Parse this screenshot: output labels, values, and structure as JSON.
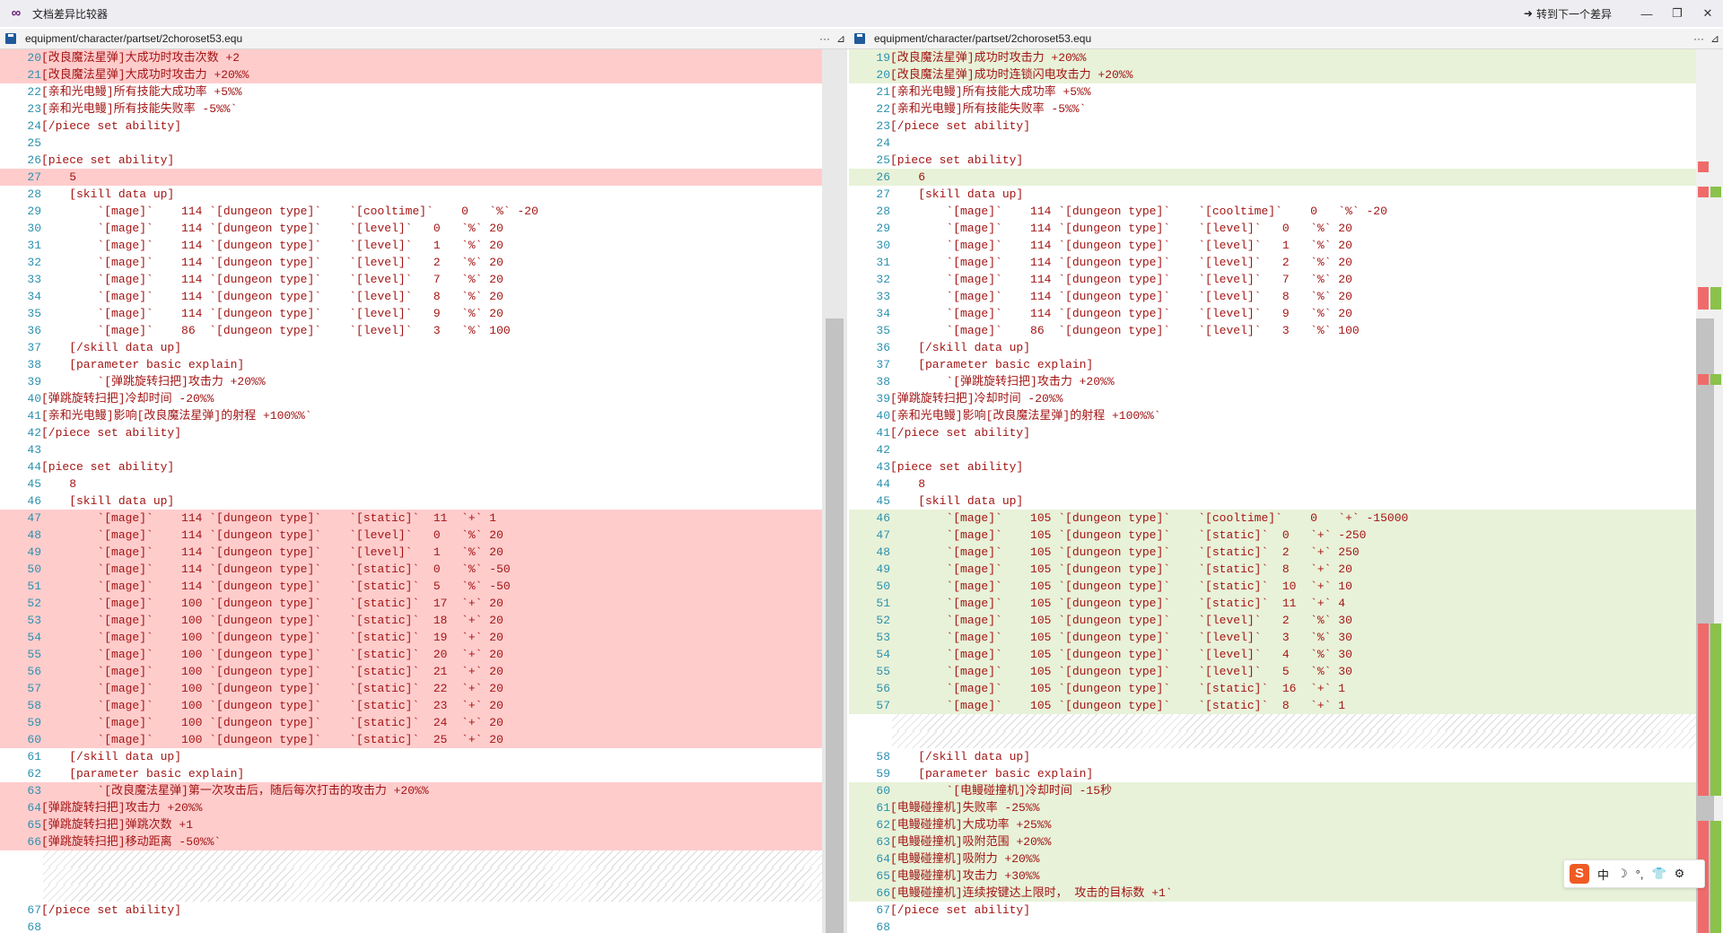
{
  "window": {
    "title": "文档差异比较器",
    "next_diff_label": "转到下一个差异",
    "app_icon": "visual-studio-icon"
  },
  "left_pane": {
    "path": "equipment/character/partset/2choroset53.equ"
  },
  "right_pane": {
    "path": "equipment/character/partset/2choroset53.equ"
  },
  "colors": {
    "removed": "#ffcccc",
    "removed_strong": "#f08e8e",
    "added": "#e8f2d8",
    "added_strong": "#c9df8e",
    "hatch": "#dadada",
    "map_red": "#ef6b6b",
    "map_green": "#8ac24a"
  },
  "left_lines": [
    {
      "n": "20",
      "t": "[改良魔法星弹]大成功时攻击次数 +2",
      "d": "r"
    },
    {
      "n": "21",
      "t": "[改良魔法星弹]大成功时攻击力 +20%%",
      "d": "r"
    },
    {
      "n": "22",
      "t": "[亲和光电鳗]所有技能大成功率 +5%%"
    },
    {
      "n": "23",
      "t": "[亲和光电鳗]所有技能失败率 -5%%`"
    },
    {
      "n": "24",
      "t": "[/piece set ability]"
    },
    {
      "n": "25",
      "t": ""
    },
    {
      "n": "26",
      "t": "[piece set ability]"
    },
    {
      "n": "27",
      "t": "    5",
      "d": "r"
    },
    {
      "n": "28",
      "t": "    [skill data up]"
    },
    {
      "n": "29",
      "t": "        `[mage]`    114 `[dungeon type]`    `[cooltime]`    0   `%` -20"
    },
    {
      "n": "30",
      "t": "        `[mage]`    114 `[dungeon type]`    `[level]`   0   `%` 20"
    },
    {
      "n": "31",
      "t": "        `[mage]`    114 `[dungeon type]`    `[level]`   1   `%` 20"
    },
    {
      "n": "32",
      "t": "        `[mage]`    114 `[dungeon type]`    `[level]`   2   `%` 20"
    },
    {
      "n": "33",
      "t": "        `[mage]`    114 `[dungeon type]`    `[level]`   7   `%` 20"
    },
    {
      "n": "34",
      "t": "        `[mage]`    114 `[dungeon type]`    `[level]`   8   `%` 20"
    },
    {
      "n": "35",
      "t": "        `[mage]`    114 `[dungeon type]`    `[level]`   9   `%` 20"
    },
    {
      "n": "36",
      "t": "        `[mage]`    86  `[dungeon type]`    `[level]`   3   `%` 100"
    },
    {
      "n": "37",
      "t": "    [/skill data up]"
    },
    {
      "n": "38",
      "t": "    [parameter basic explain]"
    },
    {
      "n": "39",
      "t": "        `[弹跳旋转扫把]攻击力 +20%%"
    },
    {
      "n": "40",
      "t": "[弹跳旋转扫把]冷却时间 -20%%"
    },
    {
      "n": "41",
      "t": "[亲和光电鳗]影响[改良魔法星弹]的射程 +100%%`"
    },
    {
      "n": "42",
      "t": "[/piece set ability]"
    },
    {
      "n": "43",
      "t": ""
    },
    {
      "n": "44",
      "t": "[piece set ability]"
    },
    {
      "n": "45",
      "t": "    8"
    },
    {
      "n": "46",
      "t": "    [skill data up]"
    },
    {
      "n": "47",
      "t": "        `[mage]`    114 `[dungeon type]`    `[static]`  11  `+` 1",
      "d": "r"
    },
    {
      "n": "48",
      "t": "        `[mage]`    114 `[dungeon type]`    `[level]`   0   `%` 20",
      "d": "r"
    },
    {
      "n": "49",
      "t": "        `[mage]`    114 `[dungeon type]`    `[level]`   1   `%` 20",
      "d": "r"
    },
    {
      "n": "50",
      "t": "        `[mage]`    114 `[dungeon type]`    `[static]`  0   `%` -50",
      "d": "r"
    },
    {
      "n": "51",
      "t": "        `[mage]`    114 `[dungeon type]`    `[static]`  5   `%` -50",
      "d": "r"
    },
    {
      "n": "52",
      "t": "        `[mage]`    100 `[dungeon type]`    `[static]`  17  `+` 20",
      "d": "r"
    },
    {
      "n": "53",
      "t": "        `[mage]`    100 `[dungeon type]`    `[static]`  18  `+` 20",
      "d": "r"
    },
    {
      "n": "54",
      "t": "        `[mage]`    100 `[dungeon type]`    `[static]`  19  `+` 20",
      "d": "r"
    },
    {
      "n": "55",
      "t": "        `[mage]`    100 `[dungeon type]`    `[static]`  20  `+` 20",
      "d": "r"
    },
    {
      "n": "56",
      "t": "        `[mage]`    100 `[dungeon type]`    `[static]`  21  `+` 20",
      "d": "r"
    },
    {
      "n": "57",
      "t": "        `[mage]`    100 `[dungeon type]`    `[static]`  22  `+` 20",
      "d": "r"
    },
    {
      "n": "58",
      "t": "        `[mage]`    100 `[dungeon type]`    `[static]`  23  `+` 20",
      "d": "r"
    },
    {
      "n": "59",
      "t": "        `[mage]`    100 `[dungeon type]`    `[static]`  24  `+` 20",
      "d": "r"
    },
    {
      "n": "60",
      "t": "        `[mage]`    100 `[dungeon type]`    `[static]`  25  `+` 20",
      "d": "r"
    },
    {
      "n": "61",
      "t": "    [/skill data up]"
    },
    {
      "n": "62",
      "t": "    [parameter basic explain]"
    },
    {
      "n": "63",
      "t": "        `[改良魔法星弹]第一次攻击后，随后每次打击的攻击力 +20%%",
      "d": "r"
    },
    {
      "n": "64",
      "t": "[弹跳旋转扫把]攻击力 +20%%",
      "d": "r"
    },
    {
      "n": "65",
      "t": "[弹跳旋转扫把]弹跳次数 +1",
      "d": "r"
    },
    {
      "n": "66",
      "t": "[弹跳旋转扫把]移动距离 -50%%`",
      "d": "r"
    },
    {
      "n": "",
      "t": "",
      "d": "h"
    },
    {
      "n": "",
      "t": "",
      "d": "h"
    },
    {
      "n": "",
      "t": "",
      "d": "h"
    },
    {
      "n": "67",
      "t": "[/piece set ability]"
    },
    {
      "n": "68",
      "t": ""
    }
  ],
  "right_lines": [
    {
      "n": "19",
      "t": "[改良魔法星弹]成功时攻击力 +20%%",
      "d": "a"
    },
    {
      "n": "20",
      "t": "[改良魔法星弹]成功时连锁闪电攻击力 +20%%",
      "d": "a"
    },
    {
      "n": "21",
      "t": "[亲和光电鳗]所有技能大成功率 +5%%"
    },
    {
      "n": "22",
      "t": "[亲和光电鳗]所有技能失败率 -5%%`"
    },
    {
      "n": "23",
      "t": "[/piece set ability]"
    },
    {
      "n": "24",
      "t": ""
    },
    {
      "n": "25",
      "t": "[piece set ability]"
    },
    {
      "n": "26",
      "t": "    6",
      "d": "a"
    },
    {
      "n": "27",
      "t": "    [skill data up]"
    },
    {
      "n": "28",
      "t": "        `[mage]`    114 `[dungeon type]`    `[cooltime]`    0   `%` -20"
    },
    {
      "n": "29",
      "t": "        `[mage]`    114 `[dungeon type]`    `[level]`   0   `%` 20"
    },
    {
      "n": "30",
      "t": "        `[mage]`    114 `[dungeon type]`    `[level]`   1   `%` 20"
    },
    {
      "n": "31",
      "t": "        `[mage]`    114 `[dungeon type]`    `[level]`   2   `%` 20"
    },
    {
      "n": "32",
      "t": "        `[mage]`    114 `[dungeon type]`    `[level]`   7   `%` 20"
    },
    {
      "n": "33",
      "t": "        `[mage]`    114 `[dungeon type]`    `[level]`   8   `%` 20"
    },
    {
      "n": "34",
      "t": "        `[mage]`    114 `[dungeon type]`    `[level]`   9   `%` 20"
    },
    {
      "n": "35",
      "t": "        `[mage]`    86  `[dungeon type]`    `[level]`   3   `%` 100"
    },
    {
      "n": "36",
      "t": "    [/skill data up]"
    },
    {
      "n": "37",
      "t": "    [parameter basic explain]"
    },
    {
      "n": "38",
      "t": "        `[弹跳旋转扫把]攻击力 +20%%"
    },
    {
      "n": "39",
      "t": "[弹跳旋转扫把]冷却时间 -20%%"
    },
    {
      "n": "40",
      "t": "[亲和光电鳗]影响[改良魔法星弹]的射程 +100%%`"
    },
    {
      "n": "41",
      "t": "[/piece set ability]"
    },
    {
      "n": "42",
      "t": ""
    },
    {
      "n": "43",
      "t": "[piece set ability]"
    },
    {
      "n": "44",
      "t": "    8"
    },
    {
      "n": "45",
      "t": "    [skill data up]"
    },
    {
      "n": "46",
      "t": "        `[mage]`    105 `[dungeon type]`    `[cooltime]`    0   `+` -15000",
      "d": "a"
    },
    {
      "n": "47",
      "t": "        `[mage]`    105 `[dungeon type]`    `[static]`  0   `+` -250",
      "d": "a"
    },
    {
      "n": "48",
      "t": "        `[mage]`    105 `[dungeon type]`    `[static]`  2   `+` 250",
      "d": "a"
    },
    {
      "n": "49",
      "t": "        `[mage]`    105 `[dungeon type]`    `[static]`  8   `+` 20",
      "d": "a"
    },
    {
      "n": "50",
      "t": "        `[mage]`    105 `[dungeon type]`    `[static]`  10  `+` 10",
      "d": "a"
    },
    {
      "n": "51",
      "t": "        `[mage]`    105 `[dungeon type]`    `[static]`  11  `+` 4",
      "d": "a"
    },
    {
      "n": "52",
      "t": "        `[mage]`    105 `[dungeon type]`    `[level]`   2   `%` 30",
      "d": "a"
    },
    {
      "n": "53",
      "t": "        `[mage]`    105 `[dungeon type]`    `[level]`   3   `%` 30",
      "d": "a"
    },
    {
      "n": "54",
      "t": "        `[mage]`    105 `[dungeon type]`    `[level]`   4   `%` 30",
      "d": "a"
    },
    {
      "n": "55",
      "t": "        `[mage]`    105 `[dungeon type]`    `[level]`   5   `%` 30",
      "d": "a"
    },
    {
      "n": "56",
      "t": "        `[mage]`    105 `[dungeon type]`    `[static]`  16  `+` 1",
      "d": "a"
    },
    {
      "n": "57",
      "t": "        `[mage]`    105 `[dungeon type]`    `[static]`  8   `+` 1",
      "d": "a"
    },
    {
      "n": "",
      "t": "",
      "d": "h"
    },
    {
      "n": "",
      "t": "",
      "d": "h"
    },
    {
      "n": "58",
      "t": "    [/skill data up]"
    },
    {
      "n": "59",
      "t": "    [parameter basic explain]"
    },
    {
      "n": "60",
      "t": "        `[电鳗碰撞机]冷却时间 -15秒",
      "d": "a"
    },
    {
      "n": "61",
      "t": "[电鳗碰撞机]失败率 -25%%",
      "d": "a"
    },
    {
      "n": "62",
      "t": "[电鳗碰撞机]大成功率 +25%%",
      "d": "a"
    },
    {
      "n": "63",
      "t": "[电鳗碰撞机]吸附范围 +20%%",
      "d": "a"
    },
    {
      "n": "64",
      "t": "[电鳗碰撞机]吸附力 +20%%",
      "d": "a"
    },
    {
      "n": "65",
      "t": "[电鳗碰撞机]攻击力 +30%%",
      "d": "a"
    },
    {
      "n": "66",
      "t": "[电鳗碰撞机]连续按键达上限时， 攻击的目标数 +1`",
      "d": "a"
    },
    {
      "n": "67",
      "t": "[/piece set ability]"
    },
    {
      "n": "68",
      "t": ""
    }
  ],
  "ime": {
    "logo": "S",
    "items": [
      "中",
      "☽",
      "°,",
      "👕",
      "⚙"
    ]
  }
}
